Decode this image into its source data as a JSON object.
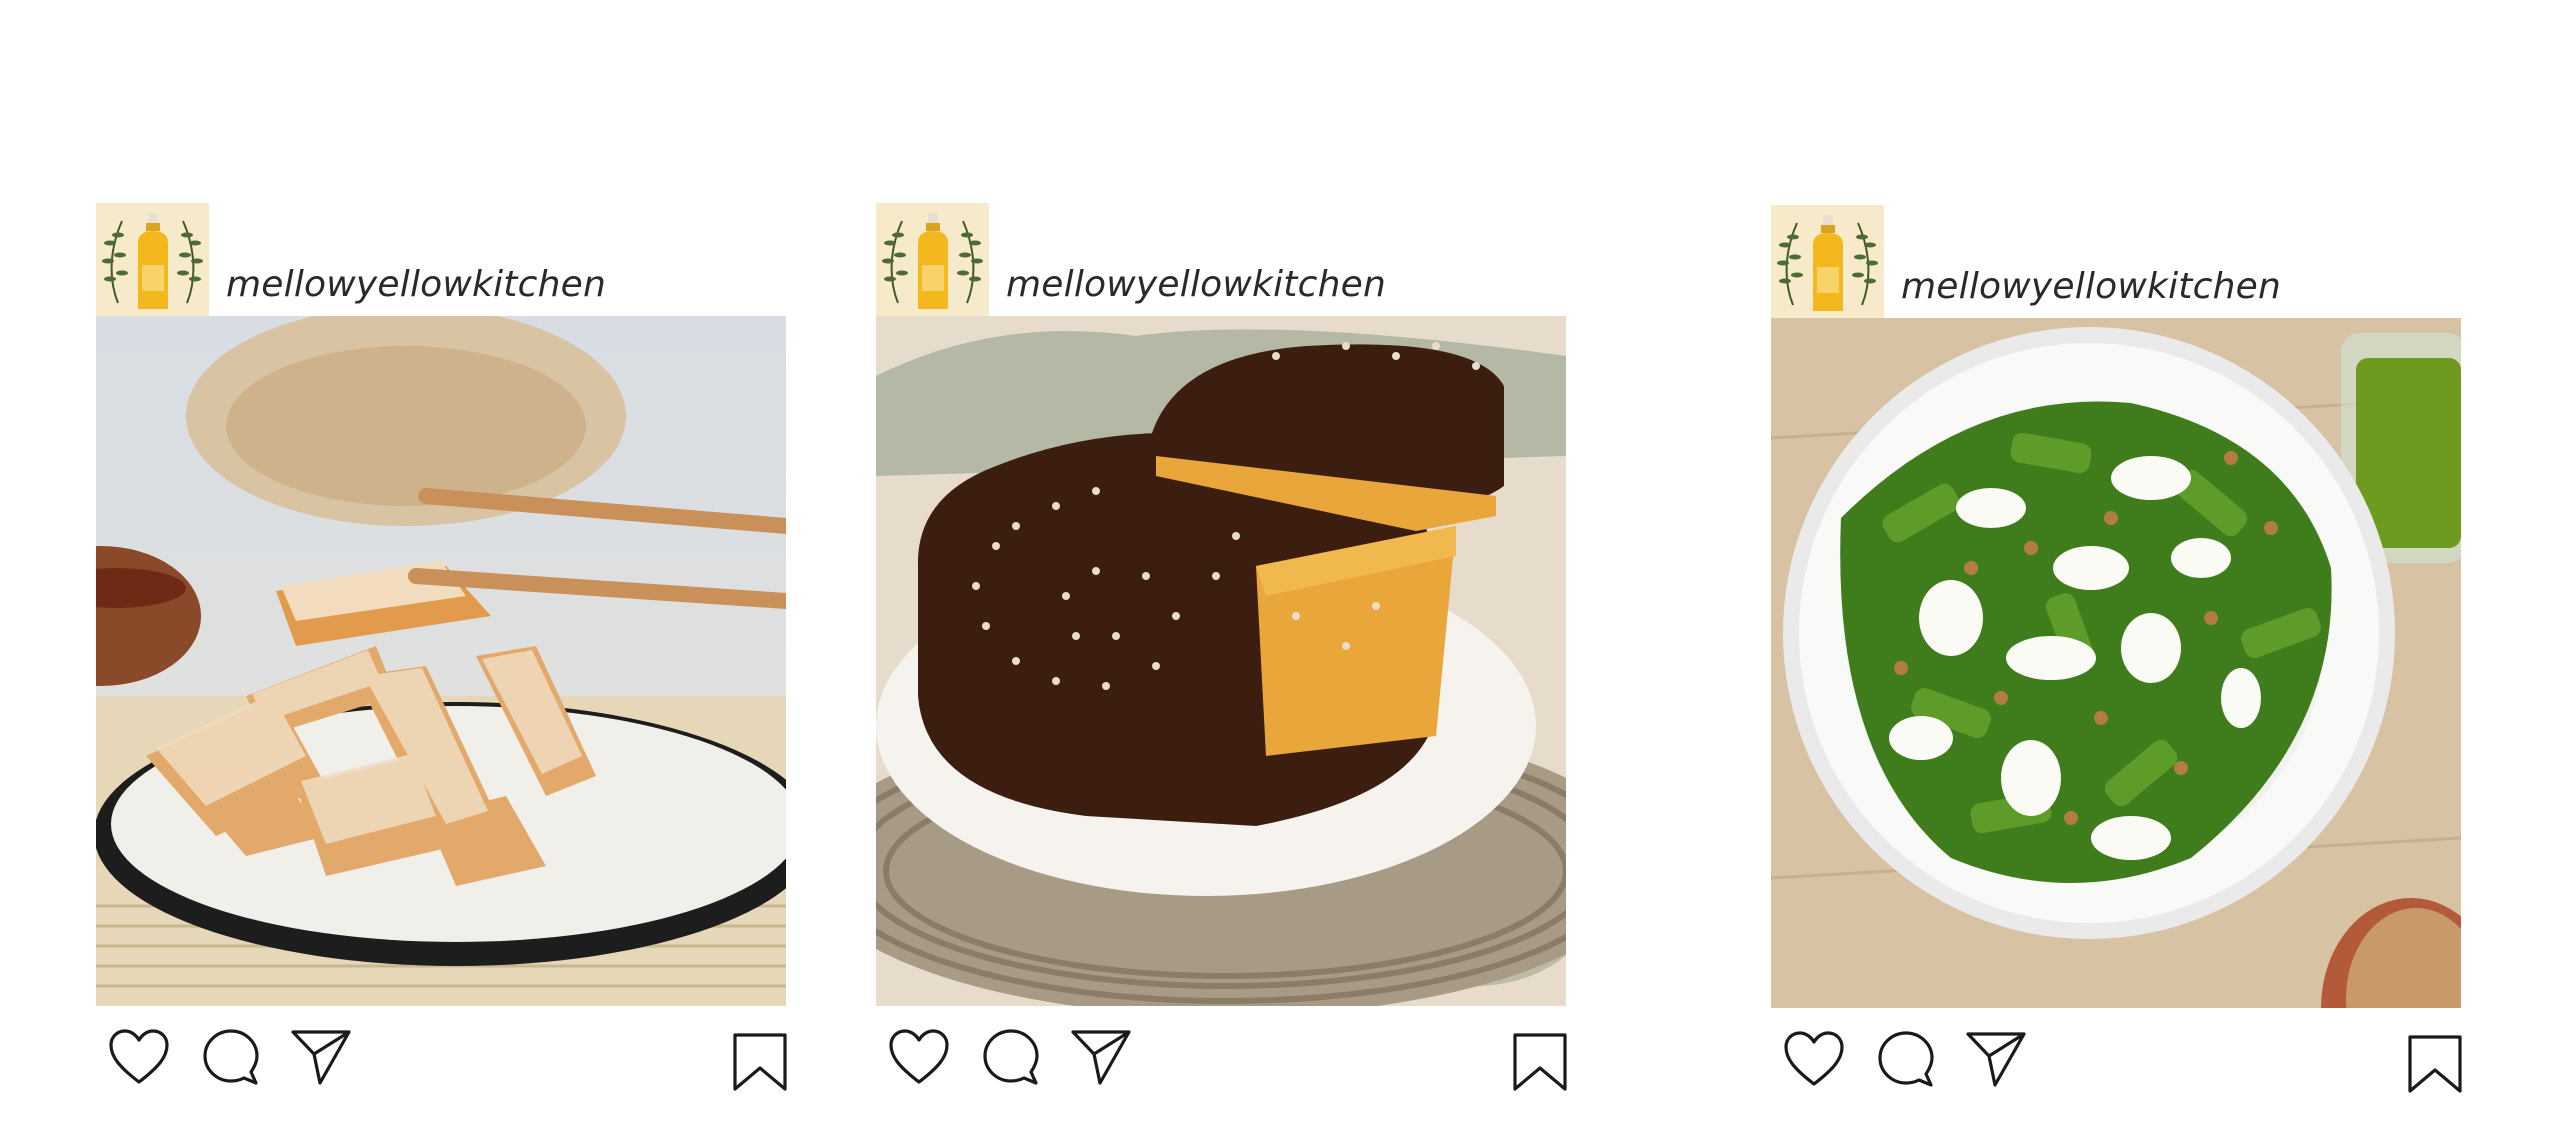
{
  "colors": {
    "avatar_bg": "#f6eacb",
    "bottle": "#f3b81e",
    "icon_stroke": "#1a1a1a"
  },
  "posts": [
    {
      "username": "mellowyellowkitchen",
      "image_subject": "sesame toast slices on a plate, one held with chopsticks",
      "icons": [
        "heart-icon",
        "comment-icon",
        "send-icon",
        "bookmark-icon"
      ]
    },
    {
      "username": "mellowyellowkitchen",
      "image_subject": "chocolate frosted cake with a slice lifted out",
      "icons": [
        "heart-icon",
        "comment-icon",
        "send-icon",
        "bookmark-icon"
      ]
    },
    {
      "username": "mellowyellowkitchen",
      "image_subject": "pesto rigatoni with mozzarella and walnuts in a white bowl",
      "icons": [
        "heart-icon",
        "comment-icon",
        "send-icon",
        "bookmark-icon"
      ]
    }
  ]
}
